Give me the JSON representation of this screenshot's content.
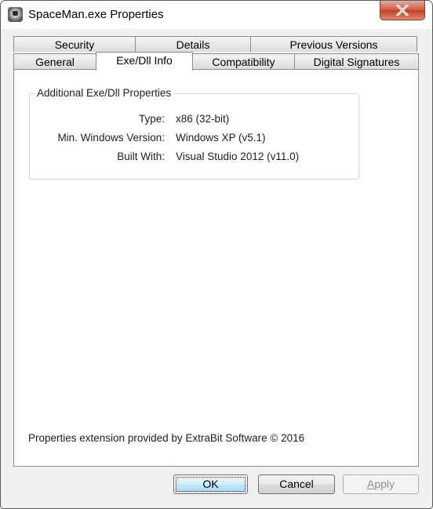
{
  "window": {
    "title": "SpaceMan.exe Properties",
    "icon": "spaceman-app-icon",
    "close_icon": "close-icon"
  },
  "tabs": {
    "row_back": [
      {
        "label": "Security"
      },
      {
        "label": "Details"
      },
      {
        "label": "Previous Versions"
      }
    ],
    "row_front": [
      {
        "label": "General"
      },
      {
        "label": "Exe/Dll Info",
        "active": true
      },
      {
        "label": "Compatibility"
      },
      {
        "label": "Digital Signatures"
      }
    ]
  },
  "group": {
    "title": "Additional Exe/Dll Properties",
    "properties": [
      {
        "label": "Type:",
        "value": "x86 (32-bit)"
      },
      {
        "label": "Min. Windows Version:",
        "value": "Windows XP (v5.1)"
      },
      {
        "label": "Built With:",
        "value": "Visual Studio 2012 (v11.0)"
      }
    ]
  },
  "footer_text": "Properties extension provided by ExtraBit Software © 2016",
  "buttons": {
    "ok": "OK",
    "cancel": "Cancel",
    "apply_mnemonic": "A",
    "apply_rest": "pply"
  }
}
